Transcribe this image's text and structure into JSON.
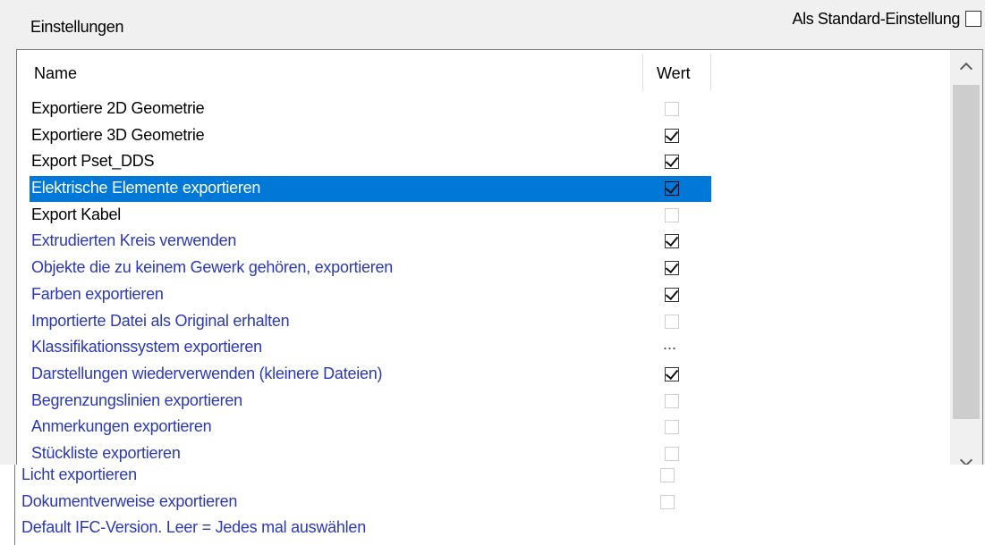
{
  "header": {
    "title": "Einstellungen",
    "standard_label": "Als Standard-Einstellung",
    "standard_checked": false
  },
  "table": {
    "col_name": "Name",
    "col_value": "Wert",
    "rows": [
      {
        "label": "Exportiere 2D Geometrie",
        "value": "unchecked",
        "color": "black"
      },
      {
        "label": "Exportiere 3D Geometrie",
        "value": "checked",
        "color": "black"
      },
      {
        "label": "Export Pset_DDS",
        "value": "checked",
        "color": "black"
      },
      {
        "label": "Elektrische Elemente exportieren",
        "value": "checked",
        "color": "black",
        "selected": true
      },
      {
        "label": "Export Kabel",
        "value": "unchecked",
        "color": "black"
      },
      {
        "label": "Extrudierten Kreis verwenden",
        "value": "checked",
        "color": "blue"
      },
      {
        "label": "Objekte die zu keinem Gewerk gehören, exportieren",
        "value": "checked",
        "color": "blue"
      },
      {
        "label": "Farben exportieren",
        "value": "checked",
        "color": "blue"
      },
      {
        "label": "Importierte Datei als Original erhalten",
        "value": "unchecked",
        "color": "blue"
      },
      {
        "label": "Klassifikationssystem exportieren",
        "value": "...",
        "color": "blue"
      },
      {
        "label": "Darstellungen wiederverwenden (kleinere Dateien)",
        "value": "checked",
        "color": "blue"
      },
      {
        "label": "Begrenzungslinien exportieren",
        "value": "unchecked",
        "color": "blue"
      },
      {
        "label": "Anmerkungen exportieren",
        "value": "unchecked",
        "color": "blue"
      },
      {
        "label": "Stückliste exportieren",
        "value": "unchecked",
        "color": "blue"
      }
    ],
    "lower_rows": [
      {
        "label": "Licht exportieren",
        "value": "unchecked",
        "color": "blue"
      },
      {
        "label": "Dokumentverweise exportieren",
        "value": "unchecked",
        "color": "blue"
      },
      {
        "label": "Default IFC-Version. Leer = Jedes mal auswählen",
        "value": "",
        "color": "blue"
      }
    ]
  },
  "colors": {
    "selection": "#0078d7",
    "blue_text": "#2b38b8",
    "background": "#f0f0f0"
  },
  "icons": {
    "scroll_up": "chevron-up-icon",
    "scroll_down": "chevron-down-icon"
  }
}
